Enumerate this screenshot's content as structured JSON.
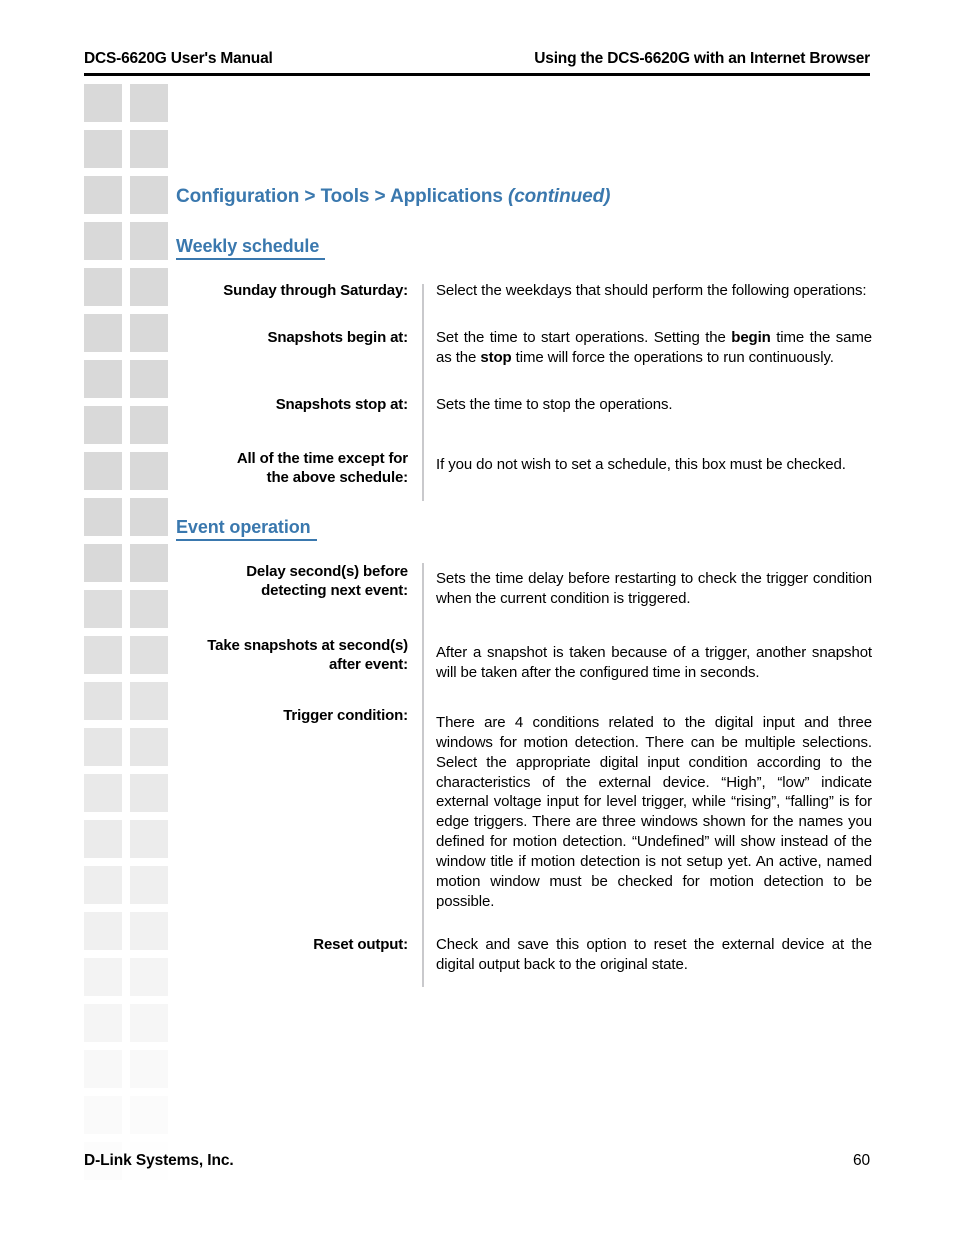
{
  "header": {
    "left": "DCS-6620G User's Manual",
    "right": "Using the DCS-6620G with an Internet Browser"
  },
  "title": {
    "breadcrumb": "Configuration > Tools > Applications",
    "continued": "(continued)"
  },
  "sections": [
    {
      "heading": "Weekly schedule",
      "rows": [
        {
          "term": "Sunday through Saturday:",
          "desc": "Select the weekdays that should perform the following operations:"
        },
        {
          "term": "Snapshots begin at:",
          "desc_part1": "Set the time to start operations. Setting the ",
          "desc_bold1": "begin",
          "desc_part2": " time the same as the ",
          "desc_bold2": "stop",
          "desc_part3": " time will force the operations to run continuously."
        },
        {
          "term": "Snapshots stop at:",
          "desc": "Sets the time to stop the operations."
        },
        {
          "term_line1": "All of the time except for",
          "term_line2": "the above schedule:",
          "desc": "If you do not wish to set a schedule, this box must be checked."
        }
      ]
    },
    {
      "heading": "Event operation",
      "rows": [
        {
          "term_line1": "Delay second(s) before",
          "term_line2": "detecting next event:",
          "desc": "Sets the time delay before restarting to check the trigger condition when the current condition is triggered."
        },
        {
          "term_line1": "Take snapshots at second(s)",
          "term_line2": "after event:",
          "desc": "After a snapshot is taken because of a trigger, another snapshot will be taken after the configured time in seconds."
        },
        {
          "term": "Trigger condition:",
          "desc": "There are 4 conditions related to the digital input and three windows for motion detection. There can be multiple selections. Select the appropriate digital input condition according to the characteristics of the external device. “High”, “low” indicate external voltage input for level trigger, while “rising”, “falling” is for edge triggers. There are three windows shown for the names you defined for  motion detection. “Undefined” will show instead of the window title if motion detection is not setup yet. An active, named motion window must be checked for motion detection to be possible."
        },
        {
          "term": "Reset output:",
          "desc": "Check and save this option to reset the external device at the digital output back to the original state."
        }
      ]
    }
  ],
  "footer": {
    "company": "D-Link Systems, Inc.",
    "page_number": "60"
  },
  "colors": {
    "heading_blue": "#3a78ae",
    "divider_gray": "#c9c9cc",
    "deco_square": "#d9d9d9"
  }
}
